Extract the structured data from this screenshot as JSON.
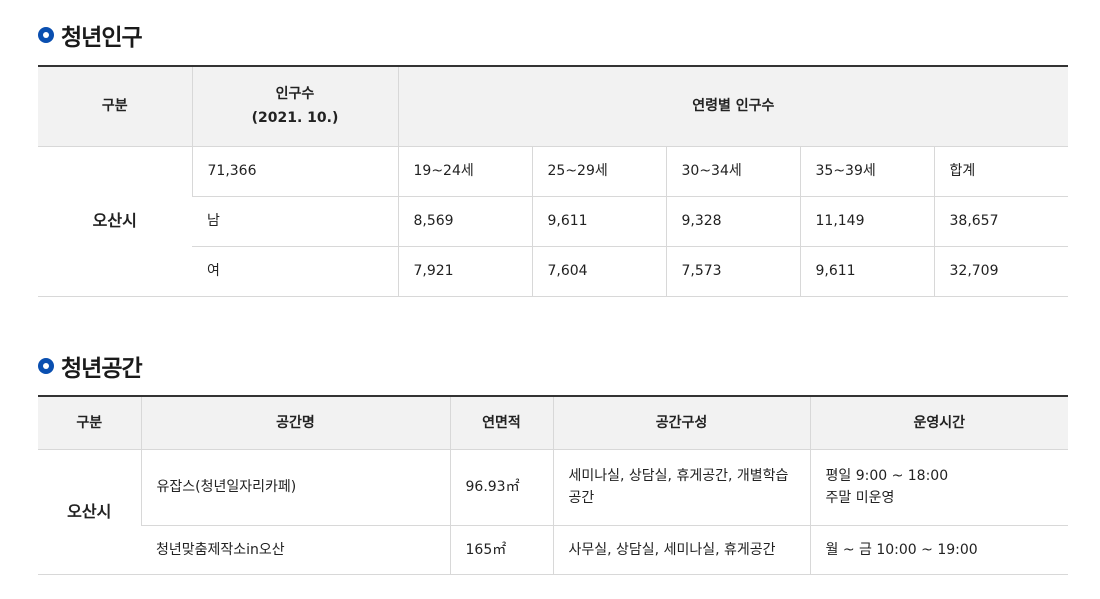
{
  "population": {
    "title": "청년인구",
    "header": {
      "category": "구분",
      "population_line1": "인구수",
      "population_line2": "(2021. 10.)",
      "by_age": "연령별 인구수"
    },
    "region": "오산시",
    "rows": [
      [
        "71,366",
        "19~24세",
        "25~29세",
        "30~34세",
        "35~39세",
        "합계"
      ],
      [
        "남",
        "8,569",
        "9,611",
        "9,328",
        "11,149",
        "38,657"
      ],
      [
        "여",
        "7,921",
        "7,604",
        "7,573",
        "9,611",
        "32,709"
      ]
    ]
  },
  "space": {
    "title": "청년공간",
    "header": {
      "category": "구분",
      "name": "공간명",
      "area": "연면적",
      "composition": "공간구성",
      "hours": "운영시간"
    },
    "region": "오산시",
    "rows": [
      {
        "name": "유잡스(청년일자리카페)",
        "area": "96.93㎡",
        "composition": "세미나실, 상담실, 휴게공간, 개별학습공간",
        "hours_line1": "평일 9:00 ~ 18:00",
        "hours_line2": "주말 미운영"
      },
      {
        "name": "청년맞춤제작소in오산",
        "area": "165㎡",
        "composition": "사무실, 상담실, 세미나실, 휴게공간",
        "hours_line1": "월 ~ 금 10:00 ~ 19:00",
        "hours_line2": ""
      }
    ]
  },
  "colors": {
    "bullet": "#0a4fb0",
    "header_bg": "#f2f2f2",
    "rule": "#333333"
  }
}
